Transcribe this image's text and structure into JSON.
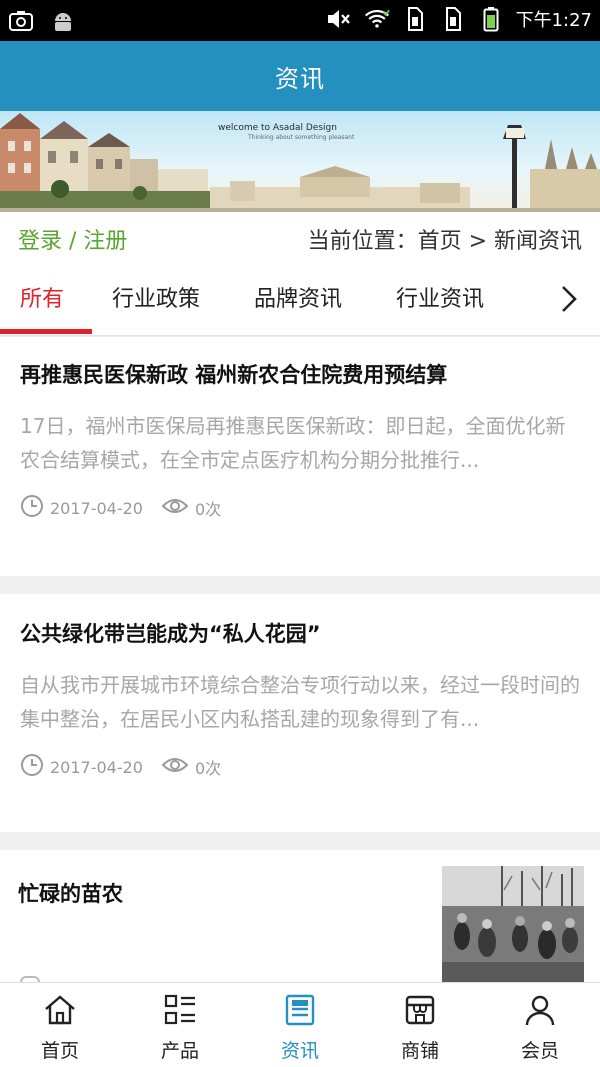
{
  "status_bar": {
    "left_icons": [
      "screenshot-icon",
      "android-icon"
    ],
    "right_icons": [
      "mute-icon",
      "wifi-icon",
      "sim1-icon",
      "sim2-icon",
      "battery-icon"
    ],
    "time": "下午1:27"
  },
  "header": {
    "title": "资讯"
  },
  "banner": {
    "tagline": "welcome to Asadal Design",
    "tagline_sub": "Thinking about something pleasant"
  },
  "crumb": {
    "login": "登录 / 注册",
    "location": "当前位置：首页 > 新闻资讯"
  },
  "tabs": {
    "items": [
      {
        "label": "所有",
        "active": true
      },
      {
        "label": "行业政策",
        "active": false
      },
      {
        "label": "品牌资讯",
        "active": false
      },
      {
        "label": "行业资讯",
        "active": false
      }
    ],
    "more_icon": "chevron-right-icon"
  },
  "articles": [
    {
      "title": "再推惠民医保新政 福州新农合住院费用预结算",
      "summary": "17日，福州市医保局再推惠民医保新政：即日起，全面优化新农合结算模式，在全市定点医疗机构分期分批推行...",
      "date": "2017-04-20",
      "views": "0次"
    },
    {
      "title": "公共绿化带岂能成为“私人花园”",
      "summary": "自从我市开展城市环境综合整治专项行动以来，经过一段时间的集中整治，在居民小区内私搭乱建的现象得到了有...",
      "date": "2017-04-20",
      "views": "0次"
    },
    {
      "title": "忙碌的苗农",
      "thumbnail": "farmers-photo"
    }
  ],
  "bottom_nav": {
    "items": [
      {
        "label": "首页",
        "icon": "home-icon",
        "active": false
      },
      {
        "label": "产品",
        "icon": "grid-list-icon",
        "active": false
      },
      {
        "label": "资讯",
        "icon": "news-icon",
        "active": true
      },
      {
        "label": "商铺",
        "icon": "store-icon",
        "active": false
      },
      {
        "label": "会员",
        "icon": "user-icon",
        "active": false
      }
    ]
  },
  "colors": {
    "header_bg": "#2390bf",
    "active_tab": "#e0212b",
    "login_green": "#5aa531",
    "nav_active": "#2390bf"
  }
}
